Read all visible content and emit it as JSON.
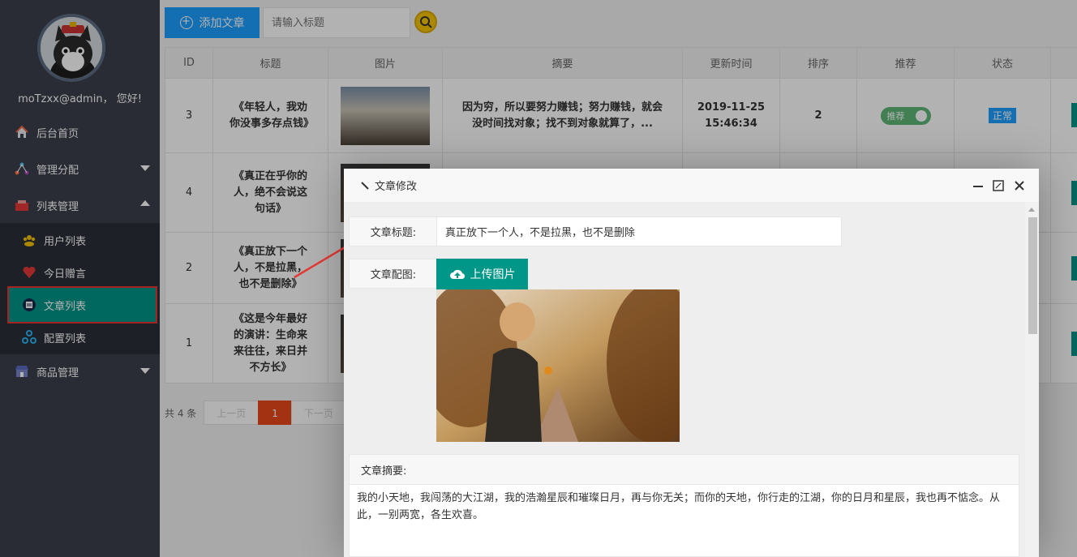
{
  "sidebar": {
    "greeting": "moTzxx@admin， 您好!",
    "items": [
      {
        "label": "后台首页",
        "icon": "home-icon"
      },
      {
        "label": "管理分配",
        "icon": "network-icon"
      },
      {
        "label": "列表管理",
        "icon": "list-icon"
      },
      {
        "label": "商品管理",
        "icon": "shop-icon"
      }
    ],
    "sub_items": [
      {
        "label": "用户列表",
        "icon": "users-icon"
      },
      {
        "label": "今日赠言",
        "icon": "heart-icon"
      },
      {
        "label": "文章列表",
        "icon": "article-icon"
      },
      {
        "label": "配置列表",
        "icon": "config-icon"
      }
    ]
  },
  "toolbar": {
    "add_label": "添加文章",
    "search_placeholder": "请输入标题"
  },
  "table": {
    "headers": [
      "ID",
      "标题",
      "图片",
      "摘要",
      "更新时间",
      "排序",
      "推荐",
      "状态"
    ],
    "rows": [
      {
        "id": "3",
        "title": "《年轻人，我劝你没事多存点钱》",
        "summary": "因为穷，所以要努力赚钱；努力赚钱，就会没时间找对象；找不到对象就算了，...",
        "date": "2019-11-25",
        "time": "15:46:34",
        "sort": "2",
        "recommend": "推荐",
        "status": "正常"
      },
      {
        "id": "4",
        "title": "《真正在乎你的人，绝不会说这句话》"
      },
      {
        "id": "2",
        "title": "《真正放下一个人，不是拉黑，也不是删除》"
      },
      {
        "id": "1",
        "title": "《这是今年最好的演讲：生命来来往往，来日并不方长》"
      }
    ]
  },
  "pager": {
    "total": "共 4 条",
    "prev": "上一页",
    "current": "1",
    "next": "下一页"
  },
  "dialog": {
    "title": "文章修改",
    "title_label": "文章标题:",
    "title_value": "真正放下一个人，不是拉黑，也不是删除",
    "image_label": "文章配图:",
    "upload_label": "上传图片",
    "summary_label": "文章摘要:",
    "summary_text": "我的小天地，我闯荡的大江湖，我的浩瀚星辰和璀璨日月，再与你无关；而你的天地，你行走的江湖，你的日月和星辰，我也再不惦念。从此，一别两宽，各生欢喜。"
  },
  "colors": {
    "sidebar_bg": "#3b3f4b",
    "accent": "#009688",
    "primary": "#1e9fff",
    "highlight_border": "#ee3333"
  }
}
